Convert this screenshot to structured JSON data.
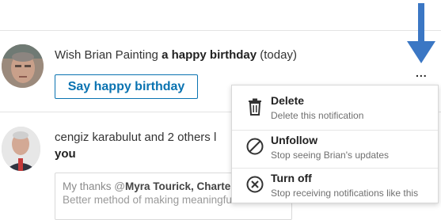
{
  "notifications": [
    {
      "prefix": "Wish Brian Painting ",
      "emphasis": "a happy birthday",
      "suffix": " (today)",
      "action_label": "Say happy birthday"
    },
    {
      "line1": "cengiz karabulut and 2 others l",
      "line2": "you",
      "comment_prefix": "My thanks @",
      "comment_mention": "Myra Tourick, Charte",
      "comment_line2": "Better method of making meaningful"
    }
  ],
  "more_button": "...",
  "menu": {
    "items": [
      {
        "title": "Delete",
        "subtitle": "Delete this notification",
        "icon": "trash-icon"
      },
      {
        "title": "Unfollow",
        "subtitle": "Stop seeing Brian's updates",
        "icon": "no-entry-icon"
      },
      {
        "title": "Turn off",
        "subtitle": "Stop receiving notifications like this",
        "icon": "close-circle-icon"
      }
    ]
  },
  "colors": {
    "accent": "#0a73b1",
    "arrow": "#3b77c4"
  }
}
